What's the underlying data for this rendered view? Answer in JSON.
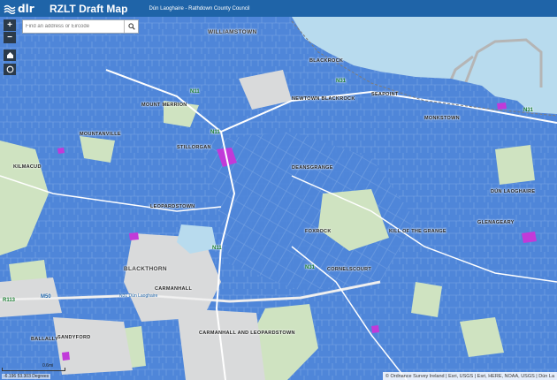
{
  "header": {
    "logo_text": "dlr",
    "title": "RZLT Draft Map",
    "subtitle": "Dún Laoghaire - Rathdown County Council"
  },
  "search": {
    "placeholder": "Find an address or Eircode"
  },
  "controls": {
    "zoom_in": "+",
    "zoom_out": "−"
  },
  "places": {
    "williamstown": "Williamstown",
    "blackrock": "Blackrock",
    "seapoint": "Seapoint",
    "mount_merrion": "Mount Merrion",
    "newtown_blackrock": "Newtown Blackrock",
    "monkstown": "Monkstown",
    "mountanville": "Mountanville",
    "stillorgan": "Stillorgan",
    "deansgrange": "Deansgrange",
    "foxrock": "Foxrock",
    "kilmacud": "Kilmacud",
    "sandyford": "Sandyford",
    "leopardstown": "Leopardstown",
    "carmanhall": "Carmanhall",
    "carmanhall_leopardstown": "Carmanhall and Leopardstown",
    "ballally": "Ballally",
    "dun_laoghaire": "Dún Laoghaire",
    "glenageary": "Glenageary",
    "kill_of_the_grange": "Kill of the Grange",
    "cornelscourt": "Cornelscourt",
    "blackthorn": "Blackthorn"
  },
  "roads": {
    "n31": "N31",
    "n11": "N11",
    "m50": "M50",
    "r113": "R113"
  },
  "signs": {
    "n31_sign": "N31 Dún Laoghaire"
  },
  "attribution": "© Ordnance Survey Ireland | Esri, USGS | Esri, HERE, NOAA, USGS | Dún La",
  "scale": {
    "coords": "-6.196 53.303 Degrees",
    "distance": "0.6mi"
  },
  "colors": {
    "header": "#1f64a8",
    "zoned": "#4f86d9",
    "sea": "#b8dbee",
    "green": "#cfe3c1",
    "purple": "#c13ad9"
  }
}
